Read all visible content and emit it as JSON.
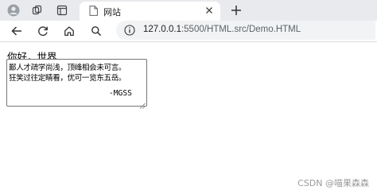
{
  "browser": {
    "tab": {
      "title": "网站"
    },
    "address": {
      "host": "127.0.0.1",
      "path": ":5500/HTML.src/Demo.HTML"
    },
    "icons": {
      "profile": "profile-icon",
      "workspaces": "workspaces-icon",
      "tab_actions": "tab-actions-icon",
      "page": "page-icon",
      "close": "close-icon",
      "new_tab": "plus-icon",
      "back": "back-arrow-icon",
      "reload": "reload-icon",
      "home": "home-icon",
      "search": "search-icon",
      "info": "info-icon"
    }
  },
  "page": {
    "greeting": "你好，世界",
    "textarea": {
      "lines": [
        "鄙人才疏学尚浅，顶峰相会未可言。",
        "狂笑过往定睛看，优可一览东五岳。"
      ],
      "signature": "-MGSS"
    }
  },
  "watermark": "CSDN @喵果森森"
}
